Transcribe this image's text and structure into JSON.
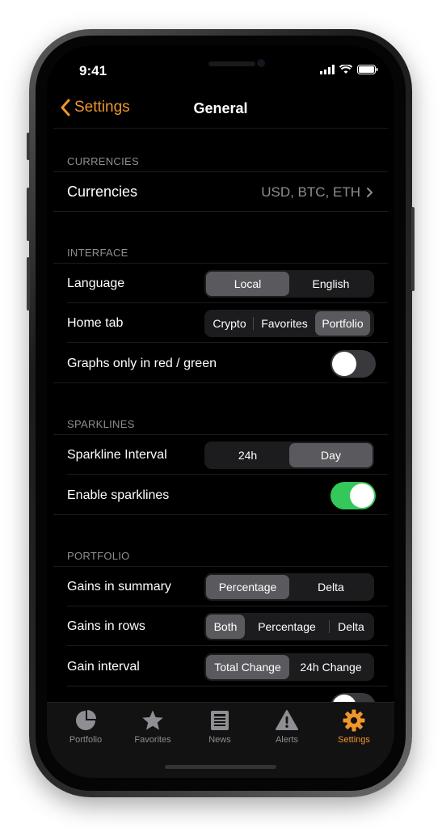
{
  "status": {
    "time": "9:41"
  },
  "nav": {
    "back_label": "Settings",
    "title": "General"
  },
  "sections": {
    "currencies": {
      "header": "CURRENCIES",
      "row_label": "Currencies",
      "value": "USD, BTC, ETH"
    },
    "interface": {
      "header": "INTERFACE",
      "language": {
        "label": "Language",
        "options": [
          "Local",
          "English"
        ],
        "selected": "Local"
      },
      "home_tab": {
        "label": "Home tab",
        "options": [
          "Crypto",
          "Favorites",
          "Portfolio"
        ],
        "selected": "Portfolio"
      },
      "graphs_red_green": {
        "label": "Graphs only in red / green",
        "on": false
      }
    },
    "sparklines": {
      "header": "SPARKLINES",
      "interval": {
        "label": "Sparkline Interval",
        "options": [
          "24h",
          "Day"
        ],
        "selected": "Day"
      },
      "enable": {
        "label": "Enable sparklines",
        "on": true
      }
    },
    "portfolio": {
      "header": "PORTFOLIO",
      "gains_summary": {
        "label": "Gains in summary",
        "options": [
          "Percentage",
          "Delta"
        ],
        "selected": "Percentage"
      },
      "gains_rows": {
        "label": "Gains in rows",
        "options": [
          "Both",
          "Percentage",
          "Delta"
        ],
        "selected": "Both"
      },
      "gain_interval": {
        "label": "Gain interval",
        "options": [
          "Total Change",
          "24h Change"
        ],
        "selected": "Total Change"
      }
    }
  },
  "tabs": [
    {
      "label": "Portfolio",
      "icon": "pie-chart-icon",
      "active": false
    },
    {
      "label": "Favorites",
      "icon": "star-icon",
      "active": false
    },
    {
      "label": "News",
      "icon": "newspaper-icon",
      "active": false
    },
    {
      "label": "Alerts",
      "icon": "warning-icon",
      "active": false
    },
    {
      "label": "Settings",
      "icon": "gear-icon",
      "active": true
    }
  ],
  "colors": {
    "accent": "#f0952c",
    "toggle_on": "#34c759",
    "background": "#000000"
  }
}
